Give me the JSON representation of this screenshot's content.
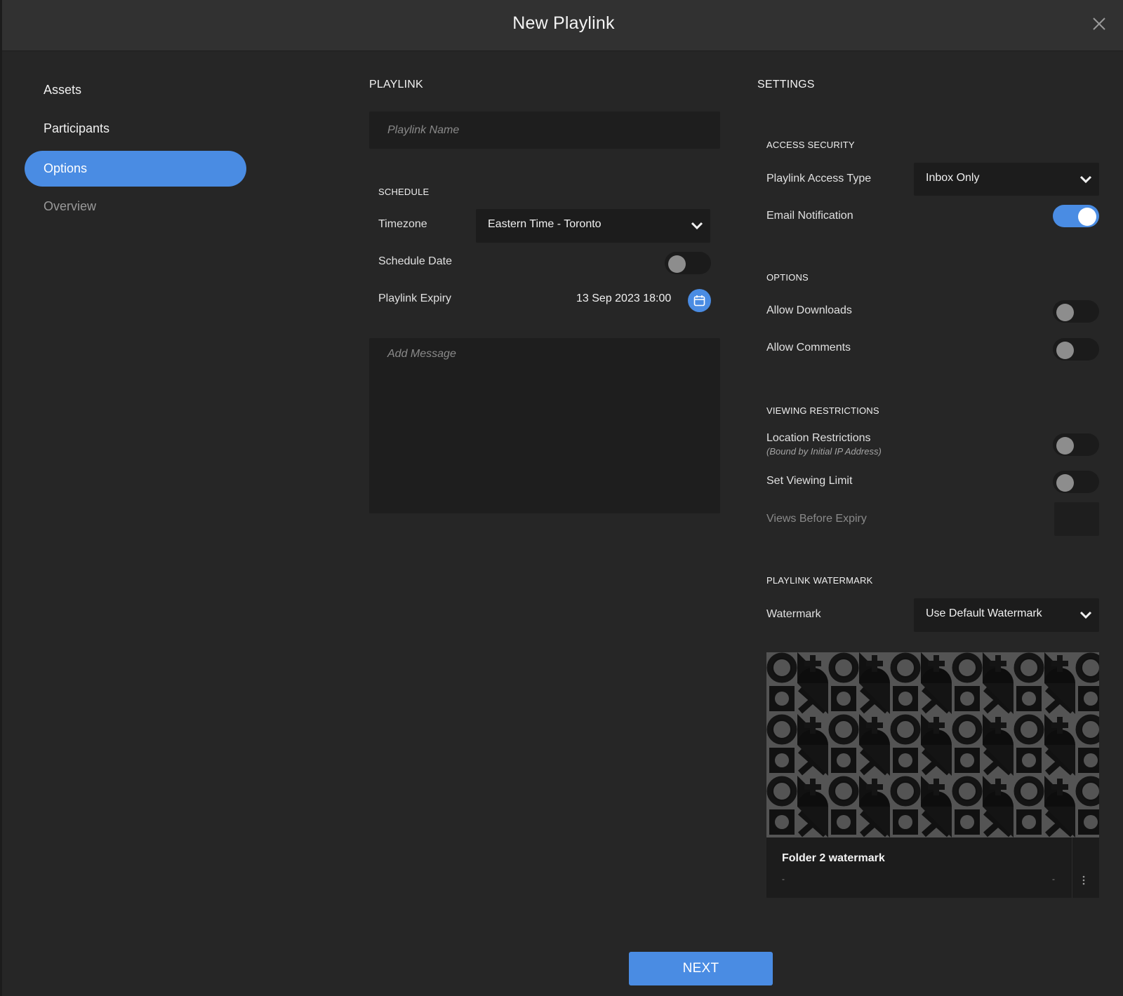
{
  "dialog": {
    "title": "New Playlink",
    "close_icon": "close-icon"
  },
  "nav": {
    "items": [
      {
        "label": "Assets",
        "state": "normal"
      },
      {
        "label": "Participants",
        "state": "normal"
      },
      {
        "label": "Options",
        "state": "active"
      },
      {
        "label": "Overview",
        "state": "disabled"
      }
    ]
  },
  "playlink": {
    "section_title": "PLAYLINK",
    "name_placeholder": "Playlink Name",
    "name_value": "",
    "schedule": {
      "title": "SCHEDULE",
      "timezone_label": "Timezone",
      "timezone_value": "Eastern Time - Toronto",
      "schedule_date_label": "Schedule Date",
      "schedule_date_enabled": false,
      "expiry_label": "Playlink Expiry",
      "expiry_value": "13 Sep 2023 18:00",
      "calendar_icon": "calendar-icon"
    },
    "message_placeholder": "Add Message",
    "message_value": ""
  },
  "settings": {
    "section_title": "SETTINGS",
    "access_security": {
      "title": "ACCESS SECURITY",
      "access_type_label": "Playlink Access Type",
      "access_type_value": "Inbox Only",
      "email_notification_label": "Email Notification",
      "email_notification_enabled": true
    },
    "options": {
      "title": "OPTIONS",
      "allow_downloads_label": "Allow Downloads",
      "allow_downloads_enabled": false,
      "allow_comments_label": "Allow Comments",
      "allow_comments_enabled": false
    },
    "viewing_restrictions": {
      "title": "VIEWING RESTRICTIONS",
      "location_label": "Location Restrictions",
      "location_sublabel": "(Bound by Initial IP Address)",
      "location_enabled": false,
      "viewing_limit_label": "Set Viewing Limit",
      "viewing_limit_enabled": false,
      "views_before_expiry_label": "Views Before Expiry",
      "views_before_expiry_value": ""
    },
    "watermark": {
      "title": "PLAYLINK WATERMARK",
      "label": "Watermark",
      "value": "Use Default Watermark",
      "preview_name": "Folder 2 watermark",
      "preview_meta_left": "-",
      "preview_meta_right": "-",
      "menu_icon": "kebab-icon"
    }
  },
  "footer": {
    "next_label": "NEXT"
  },
  "colors": {
    "accent": "#4a8ce3",
    "background": "#262626",
    "header": "#313131",
    "input": "#1e1e1e"
  }
}
